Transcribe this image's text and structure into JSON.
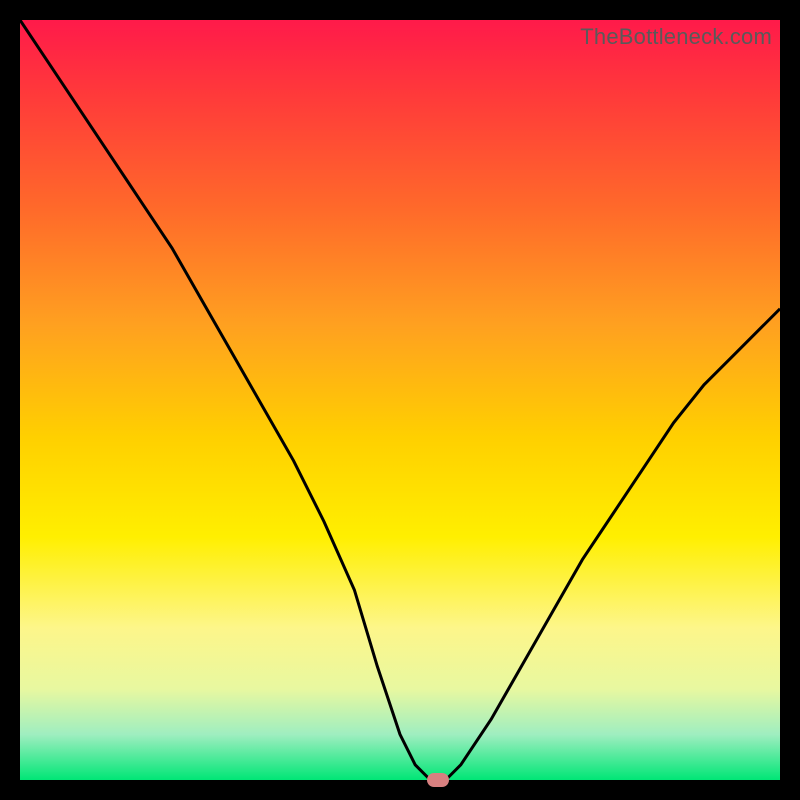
{
  "watermark": "TheBottleneck.com",
  "chart_data": {
    "type": "line",
    "title": "",
    "xlabel": "",
    "ylabel": "",
    "xlim": [
      0,
      100
    ],
    "ylim": [
      0,
      100
    ],
    "legend": [],
    "annotations": [],
    "grid": false,
    "series": [
      {
        "name": "bottleneck-curve",
        "x": [
          0,
          4,
          8,
          12,
          16,
          20,
          24,
          28,
          32,
          36,
          40,
          44,
          47,
          50,
          52,
          54,
          56,
          58,
          62,
          66,
          70,
          74,
          78,
          82,
          86,
          90,
          94,
          98,
          100
        ],
        "values": [
          100,
          94,
          88,
          82,
          76,
          70,
          63,
          56,
          49,
          42,
          34,
          25,
          15,
          6,
          2,
          0,
          0,
          2,
          8,
          15,
          22,
          29,
          35,
          41,
          47,
          52,
          56,
          60,
          62
        ]
      }
    ],
    "marker": {
      "x": 55,
      "y": 0,
      "color": "#d88080"
    },
    "background_gradient": {
      "stops": [
        {
          "pos": 0,
          "color": "#ff1a4a"
        },
        {
          "pos": 0.25,
          "color": "#ff6a2a"
        },
        {
          "pos": 0.55,
          "color": "#ffd000"
        },
        {
          "pos": 0.8,
          "color": "#fdf68a"
        },
        {
          "pos": 1.0,
          "color": "#00e676"
        }
      ]
    }
  }
}
